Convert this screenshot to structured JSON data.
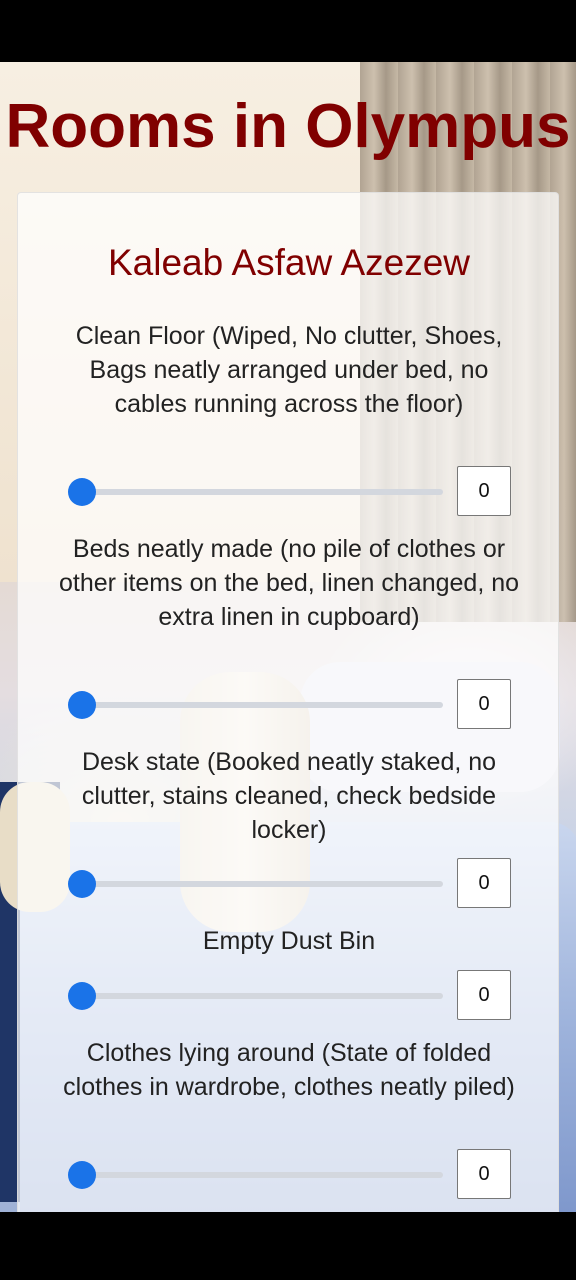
{
  "page": {
    "title": "Rooms in Olympus"
  },
  "card": {
    "person_name": "Kaleab Asfaw Azezew",
    "criteria": [
      {
        "label": "Clean Floor (Wiped, No clutter, Shoes, Bags neatly arranged under bed, no cables running across the floor)",
        "value": "0"
      },
      {
        "label": "Beds neatly made (no pile of clothes or other items on the bed, linen changed, no extra linen in cupboard)",
        "value": "0"
      },
      {
        "label": "Desk state (Booked neatly staked, no clutter, stains cleaned, check bedside locker)",
        "value": "0"
      },
      {
        "label": "Empty Dust Bin",
        "value": "0"
      },
      {
        "label": "Clothes lying around (State of folded clothes in wardrobe, clothes neatly piled)",
        "value": "0"
      }
    ]
  },
  "colors": {
    "title": "#800000",
    "slider_thumb": "#1a73e8",
    "slider_track": "#d3d7de"
  }
}
